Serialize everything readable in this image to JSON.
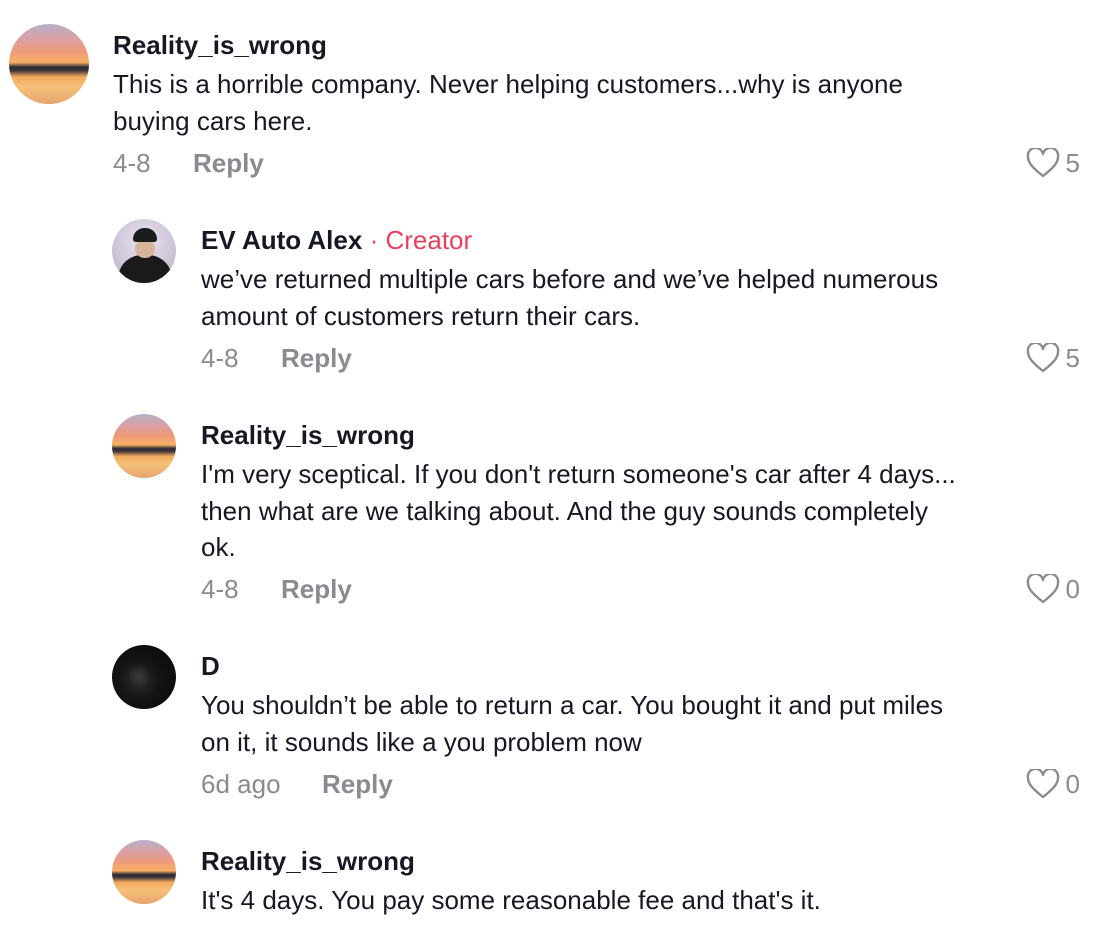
{
  "comments": [
    {
      "username": "Reality_is_wrong",
      "text_lines": [
        "This is a horrible company. Never helping customers...why is anyone",
        "buying cars here."
      ],
      "date": "4-8",
      "reply_label": "Reply",
      "likes": "5"
    },
    {
      "username": "EV Auto Alex",
      "badge_separator": "·",
      "badge": "Creator",
      "text_lines": [
        "we’ve returned multiple cars before and we’ve helped numerous",
        "amount of customers return their cars."
      ],
      "date": "4-8",
      "reply_label": "Reply",
      "likes": "5"
    },
    {
      "username": "Reality_is_wrong",
      "text_lines": [
        "I'm very sceptical. If you don't return someone's car after 4 days...",
        "then what are we talking about. And the guy sounds completely",
        "ok."
      ],
      "date": "4-8",
      "reply_label": "Reply",
      "likes": "0"
    },
    {
      "username": "D",
      "text_lines": [
        "You shouldn’t be able to return a car. You bought it and put miles",
        "on it, it sounds like a you problem now"
      ],
      "date": "6d ago",
      "reply_label": "Reply",
      "likes": "0"
    },
    {
      "username": "Reality_is_wrong",
      "text_lines": [
        "It's 4 days. You pay some reasonable fee and that's it."
      ]
    }
  ],
  "colors": {
    "creator_accent": "#e8415f",
    "meta_text": "#8a8b91",
    "primary_text": "#161823"
  },
  "icons": {
    "like": "heart-outline-icon"
  }
}
